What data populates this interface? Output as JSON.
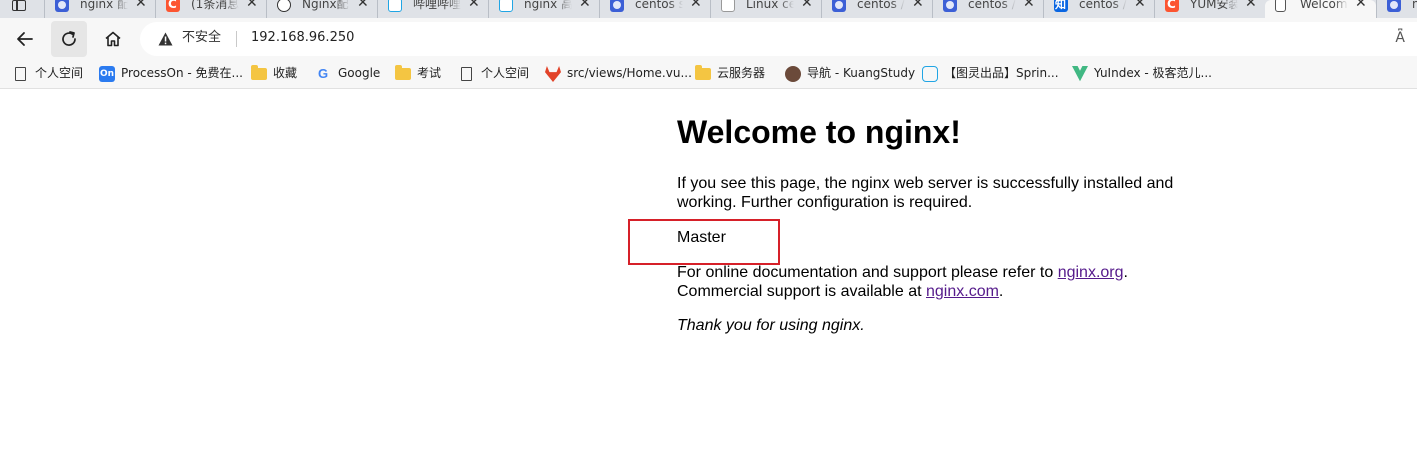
{
  "tabs": [
    {
      "title": "nginx 配",
      "favicon": "baidu-paw-icon",
      "active": false
    },
    {
      "title": "(1条消息",
      "favicon": "csdn-icon",
      "active": false
    },
    {
      "title": "Nginx配",
      "favicon": "github-icon",
      "active": false
    },
    {
      "title": "哔哩哔哩",
      "favicon": "bilibili-icon",
      "active": false
    },
    {
      "title": "nginx 高",
      "favicon": "bilibili-icon",
      "active": false
    },
    {
      "title": "centos s",
      "favicon": "baidu-paw-icon",
      "active": false
    },
    {
      "title": "Linux ce",
      "favicon": "linux-icon",
      "active": false
    },
    {
      "title": "centos /",
      "favicon": "baidu-paw-icon",
      "active": false
    },
    {
      "title": "centos /",
      "favicon": "baidu-paw-icon",
      "active": false
    },
    {
      "title": "centos /",
      "favicon": "zhihu-icon",
      "active": false
    },
    {
      "title": "YUM安装",
      "favicon": "csdn-icon",
      "active": false
    },
    {
      "title": "Welcome",
      "favicon": "document-icon",
      "active": true
    },
    {
      "title": "n",
      "favicon": "baidu-paw-icon",
      "active": false
    }
  ],
  "tab_close_glyph": "✕",
  "address_bar": {
    "security_label": "不安全",
    "url": "192.168.96.250",
    "read_aloud": "A͆"
  },
  "bookmarks": [
    {
      "label": "个人空间",
      "icon": "page-icon"
    },
    {
      "label": "ProcessOn - 免费在...",
      "icon": "processon-icon"
    },
    {
      "label": "收藏",
      "icon": "folder-icon"
    },
    {
      "label": "Google",
      "icon": "google-icon"
    },
    {
      "label": "考试",
      "icon": "folder-icon"
    },
    {
      "label": "个人空间",
      "icon": "page-icon"
    },
    {
      "label": "src/views/Home.vu...",
      "icon": "gitlab-icon"
    },
    {
      "label": "云服务器",
      "icon": "folder-icon"
    },
    {
      "label": "导航 - KuangStudy",
      "icon": "avatar-icon"
    },
    {
      "label": "【图灵出品】Sprin...",
      "icon": "bilibili-icon"
    },
    {
      "label": "YuIndex - 极客范儿...",
      "icon": "vue-icon"
    }
  ],
  "processon_badge": "On",
  "google_letter": "G",
  "page": {
    "heading": "Welcome to nginx!",
    "intro": "If you see this page, the nginx web server is successfully installed and working. Further configuration is required.",
    "server_name": "Master",
    "docs_prefix": "For online documentation and support please refer to ",
    "docs_link": "nginx.org",
    "docs_suffix": ".",
    "commercial_prefix": "Commercial support is available at ",
    "commercial_link": "nginx.com",
    "commercial_suffix": ".",
    "thanks": "Thank you for using nginx."
  },
  "colors": {
    "link": "#551a8b",
    "highlight": "#d62029",
    "tabstrip": "#dfe2e7",
    "toolbar": "#f7f7f7"
  }
}
